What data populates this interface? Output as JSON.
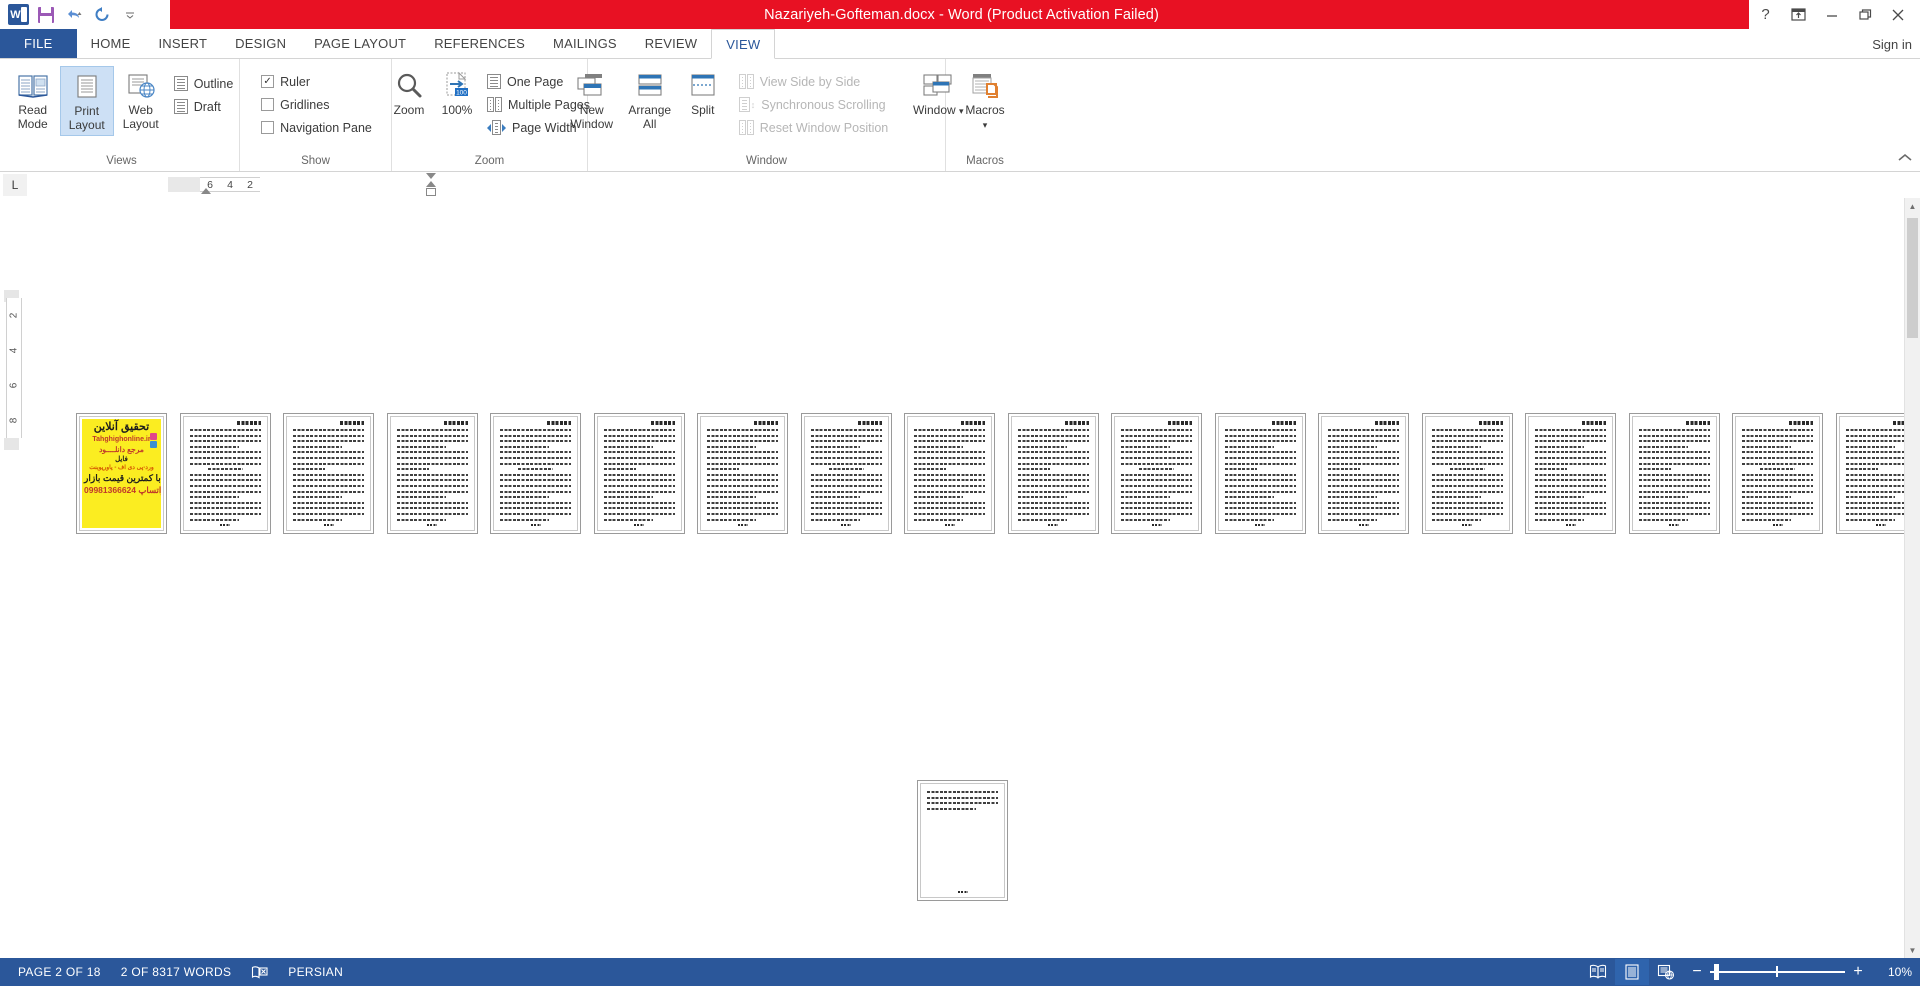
{
  "titlebar": {
    "document_title": "Nazariyeh-Gofteman.docx  -  Word (Product Activation Failed)",
    "app_logo": "word-logo",
    "quick_access": [
      {
        "name": "save-icon",
        "label": "Save"
      },
      {
        "name": "undo-icon",
        "label": "Undo"
      },
      {
        "name": "redo-icon",
        "label": "Redo"
      },
      {
        "name": "customize-qat-icon",
        "label": "Customize Quick Access Toolbar"
      }
    ],
    "help_label": "?",
    "ribbon_display_label": "Ribbon Display Options",
    "minimize_label": "Minimize",
    "restore_label": "Restore Down",
    "close_label": "Close",
    "sign_in": "Sign in"
  },
  "tabs": {
    "file": "FILE",
    "items": [
      {
        "label": "HOME",
        "active": false
      },
      {
        "label": "INSERT",
        "active": false
      },
      {
        "label": "DESIGN",
        "active": false
      },
      {
        "label": "PAGE LAYOUT",
        "active": false
      },
      {
        "label": "REFERENCES",
        "active": false
      },
      {
        "label": "MAILINGS",
        "active": false
      },
      {
        "label": "REVIEW",
        "active": false
      },
      {
        "label": "VIEW",
        "active": true
      }
    ]
  },
  "ribbon": {
    "groups": {
      "views": {
        "label": "Views",
        "read_mode": "Read\nMode",
        "print_layout": "Print\nLayout",
        "web_layout": "Web\nLayout",
        "outline": "Outline",
        "draft": "Draft",
        "selected": "Print Layout"
      },
      "show": {
        "label": "Show",
        "ruler": "Ruler",
        "ruler_checked": true,
        "gridlines": "Gridlines",
        "gridlines_checked": false,
        "navigation_pane": "Navigation Pane",
        "navigation_checked": false
      },
      "zoom": {
        "label": "Zoom",
        "zoom": "Zoom",
        "one_hundred": "100%",
        "one_page": "One Page",
        "multiple_pages": "Multiple Pages",
        "page_width": "Page Width"
      },
      "window": {
        "label": "Window",
        "new_window": "New\nWindow",
        "arrange_all": "Arrange\nAll",
        "split": "Split",
        "view_side_by_side": "View Side by Side",
        "synchronous_scrolling": "Synchronous Scrolling",
        "reset_window_position": "Reset Window Position"
      },
      "macros": {
        "label": "Macros",
        "macros": "Macros"
      }
    },
    "collapse_label": "Collapse the Ribbon"
  },
  "ruler": {
    "tab_selector": "L",
    "h_ticks": [
      "6",
      "4",
      "2"
    ],
    "v_ticks": [
      "2",
      "4",
      "6",
      "8"
    ]
  },
  "document": {
    "page_count_shown": 19,
    "ad_page": {
      "line1": "تحقیق آنلاین",
      "line2": "Tahghighonline.ir",
      "line3": "مرجع دانلــــود",
      "line4": "فایل",
      "line5": "ورد-پی دی اف - پاورپوینت",
      "line6": "با کمترین قیمت بازار",
      "line7": "09981366624 واتساپ"
    }
  },
  "statusbar": {
    "page_indicator": "PAGE 2 OF 18",
    "word_count": "2 OF 8317 WORDS",
    "proofing_icon": "proofing-errors-icon",
    "language": "PERSIAN",
    "view_read_mode": "read-mode-icon",
    "view_print_layout": "print-layout-icon",
    "view_web_layout": "web-layout-icon",
    "zoom_out": "−",
    "zoom_in": "+",
    "zoom_level": "10%"
  },
  "colors": {
    "title_bar_red": "#e81123",
    "word_blue": "#2b579a",
    "selected_tab": "#2b579a",
    "ad_yellow": "#fbed21",
    "ad_red": "#c0392b"
  }
}
